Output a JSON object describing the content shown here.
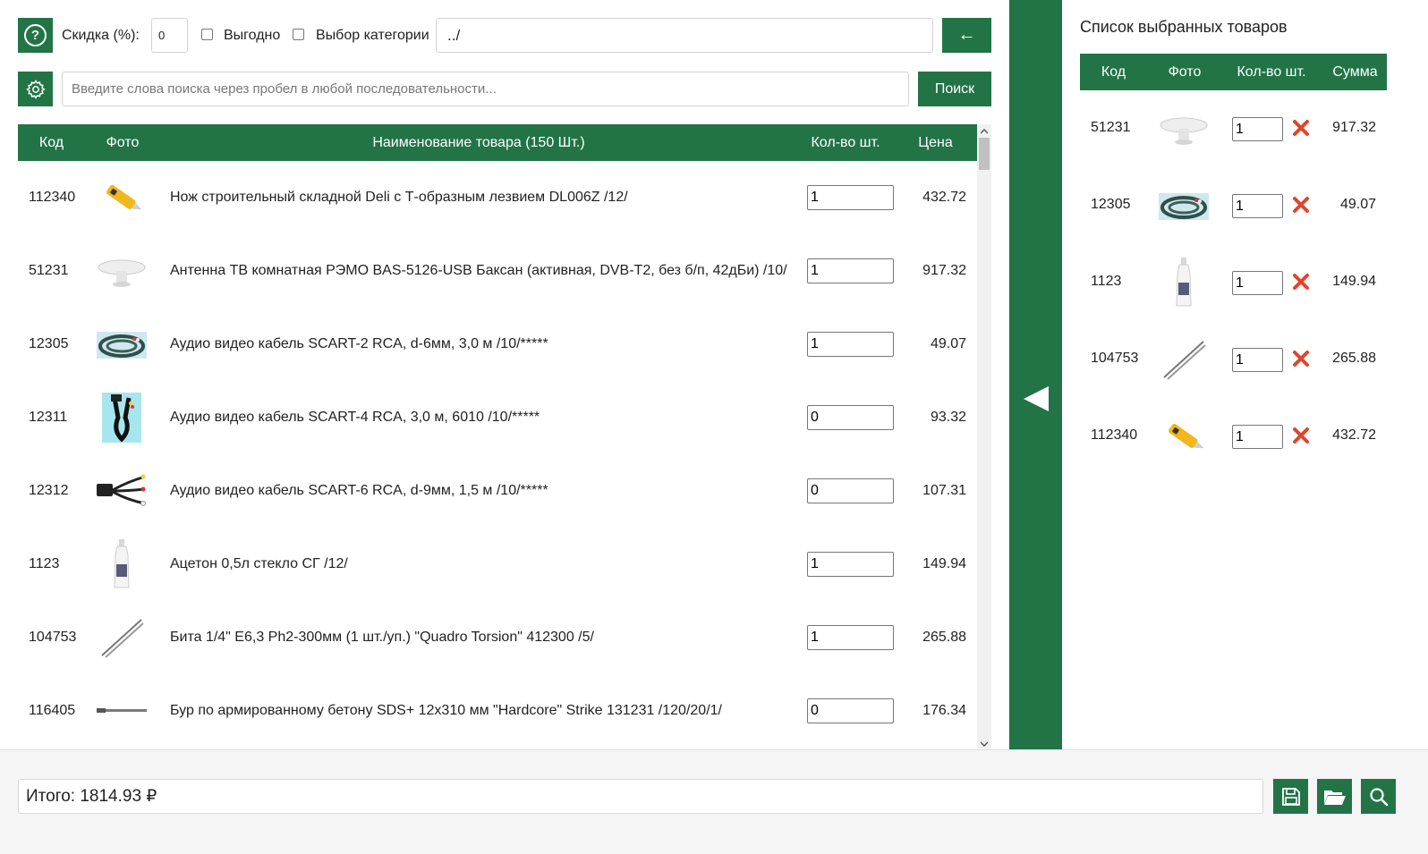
{
  "toolbar": {
    "help_icon": "question-circle-icon",
    "discount_label": "Скидка (%):",
    "discount_value": "0",
    "profitable_label": "Выгодно",
    "category_label": "Выбор категории",
    "path_value": "../",
    "back_label": "←",
    "search_placeholder": "Введите слова поиска через пробел в любой последовательности...",
    "search_label": "Поиск",
    "accent_color": "#227446"
  },
  "products": {
    "headers": {
      "code": "Код",
      "photo": "Фото",
      "name": "Наименование товара (150 Шт.)",
      "qty": "Кол-во шт.",
      "price": "Цена"
    },
    "rows": [
      {
        "code": "112340",
        "photo": "knife-photo",
        "name": "Нож строительный складной Deli с Т-образным лезвием DL006Z /12/",
        "qty": "1",
        "price": "432.72"
      },
      {
        "code": "51231",
        "photo": "antenna-photo",
        "name": "Антенна ТВ комнатная РЭМО BAS-5126-USB Баксан (активная, DVB-T2, без б/п, 42дБи) /10/",
        "qty": "1",
        "price": "917.32"
      },
      {
        "code": "12305",
        "photo": "cable-coil-photo",
        "name": "Аудио видео кабель SCART-2 RCA, d-6мм, 3,0 м /10/*****",
        "qty": "1",
        "price": "49.07"
      },
      {
        "code": "12311",
        "photo": "cable-black-photo",
        "name": "Аудио видео кабель SCART-4 RCA, 3,0 м, 6010 /10/*****",
        "qty": "0",
        "price": "93.32"
      },
      {
        "code": "12312",
        "photo": "scart-cable-photo",
        "name": "Аудио видео кабель SCART-6 RCA, d-9мм, 1,5 м /10/*****",
        "qty": "0",
        "price": "107.31"
      },
      {
        "code": "1123",
        "photo": "bottle-photo",
        "name": "Ацетон 0,5л стекло СГ /12/",
        "qty": "1",
        "price": "149.94"
      },
      {
        "code": "104753",
        "photo": "bit-photo",
        "name": "Бита 1/4\" E6,3 Ph2-300мм (1 шт./уп.) \"Quadro Torsion\" 412300 /5/",
        "qty": "1",
        "price": "265.88"
      },
      {
        "code": "116405",
        "photo": "drill-photo",
        "name": "Бур по армированному бетону SDS+ 12x310 мм \"Hardcore\" Strike 131231 /120/20/1/",
        "qty": "0",
        "price": "176.34"
      }
    ]
  },
  "selected": {
    "title": "Список выбранных товаров",
    "headers": {
      "code": "Код",
      "photo": "Фото",
      "qty": "Кол-во шт.",
      "sum": "Сумма"
    },
    "rows": [
      {
        "code": "51231",
        "photo": "antenna-photo",
        "qty": "1",
        "sum": "917.32"
      },
      {
        "code": "12305",
        "photo": "cable-coil-photo",
        "qty": "1",
        "sum": "49.07"
      },
      {
        "code": "1123",
        "photo": "bottle-photo",
        "qty": "1",
        "sum": "149.94"
      },
      {
        "code": "104753",
        "photo": "bit-photo",
        "qty": "1",
        "sum": "265.88"
      },
      {
        "code": "112340",
        "photo": "knife-photo",
        "qty": "1",
        "sum": "432.72"
      }
    ],
    "delete_icon": "close-x-icon",
    "delete_color": "#e0452b"
  },
  "footer": {
    "total_text": "Итого: 1814.93 ₽",
    "save_icon": "save-icon",
    "open_icon": "folder-open-icon",
    "search_icon": "search-icon"
  }
}
